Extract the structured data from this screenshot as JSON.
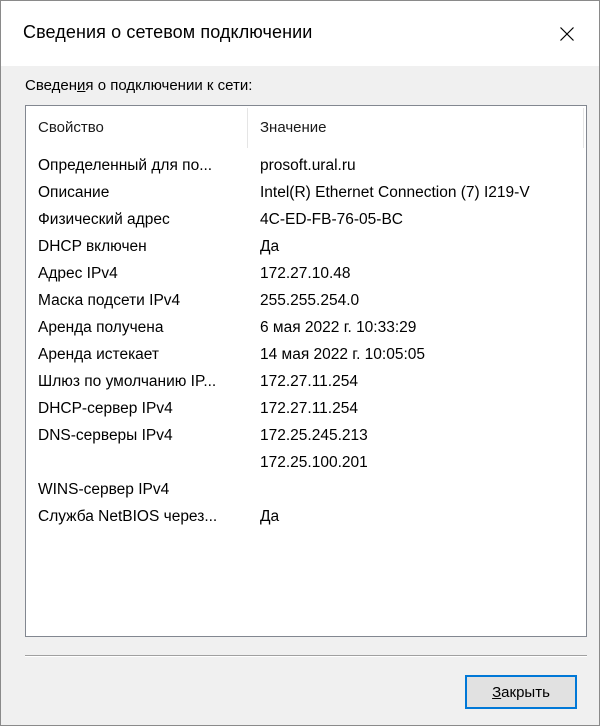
{
  "window": {
    "title": "Сведения о сетевом подключении",
    "close_icon": "close-icon"
  },
  "group": {
    "label_before": "Сведен",
    "label_mnemonic": "и",
    "label_after": "я о подключении к сети:"
  },
  "table": {
    "headers": [
      "Свойство",
      "Значение"
    ],
    "rows": [
      {
        "property": "Определенный для по...",
        "value": "prosoft.ural.ru"
      },
      {
        "property": "Описание",
        "value": "Intel(R) Ethernet Connection (7) I219-V"
      },
      {
        "property": "Физический адрес",
        "value": "4C-ED-FB-76-05-BC"
      },
      {
        "property": "DHCP включен",
        "value": "Да"
      },
      {
        "property": "Адрес IPv4",
        "value": "172.27.10.48"
      },
      {
        "property": "Маска подсети IPv4",
        "value": "255.255.254.0"
      },
      {
        "property": "Аренда получена",
        "value": "6 мая 2022 г. 10:33:29"
      },
      {
        "property": "Аренда истекает",
        "value": "14 мая 2022 г. 10:05:05"
      },
      {
        "property": "Шлюз по умолчанию IP...",
        "value": "172.27.11.254"
      },
      {
        "property": "DHCP-сервер IPv4",
        "value": "172.27.11.254"
      },
      {
        "property": "DNS-серверы IPv4",
        "value": "172.25.245.213"
      },
      {
        "property": "",
        "value": "172.25.100.201"
      },
      {
        "property": "WINS-сервер IPv4",
        "value": ""
      },
      {
        "property": "Служба NetBIOS через...",
        "value": "Да"
      }
    ]
  },
  "buttons": {
    "close_mnemonic": "З",
    "close_rest": "акрыть"
  },
  "colors": {
    "focus_border": "#0078d7",
    "dialog_bg": "#f0f0f0",
    "list_border": "#828790"
  }
}
